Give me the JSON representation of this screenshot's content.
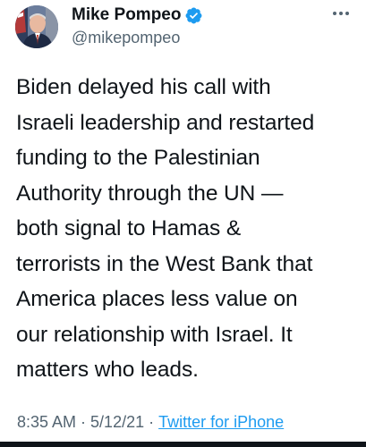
{
  "author": {
    "display_name": "Mike Pompeo",
    "handle": "@mikepompeo",
    "verified": true,
    "avatar_icon": "profile-photo-avatar"
  },
  "tweet": {
    "text": "Biden delayed his call with\nIsraeli leadership and restarted\nfunding to the Palestinian\nAuthority through the UN —\nboth signal to Hamas &\nterrorists in the West Bank that\nAmerica places less value on\nour relationship with Israel. It\nmatters who leads."
  },
  "meta": {
    "time": "8:35 AM",
    "separator": "·",
    "date": "5/12/21",
    "source": "Twitter for iPhone"
  },
  "icons": {
    "verified": "verified-badge-icon",
    "more": "more-options-icon"
  },
  "colors": {
    "text": "#0f1419",
    "secondary": "#536471",
    "link": "#1d9bf0",
    "verified": "#1d9bf0"
  }
}
